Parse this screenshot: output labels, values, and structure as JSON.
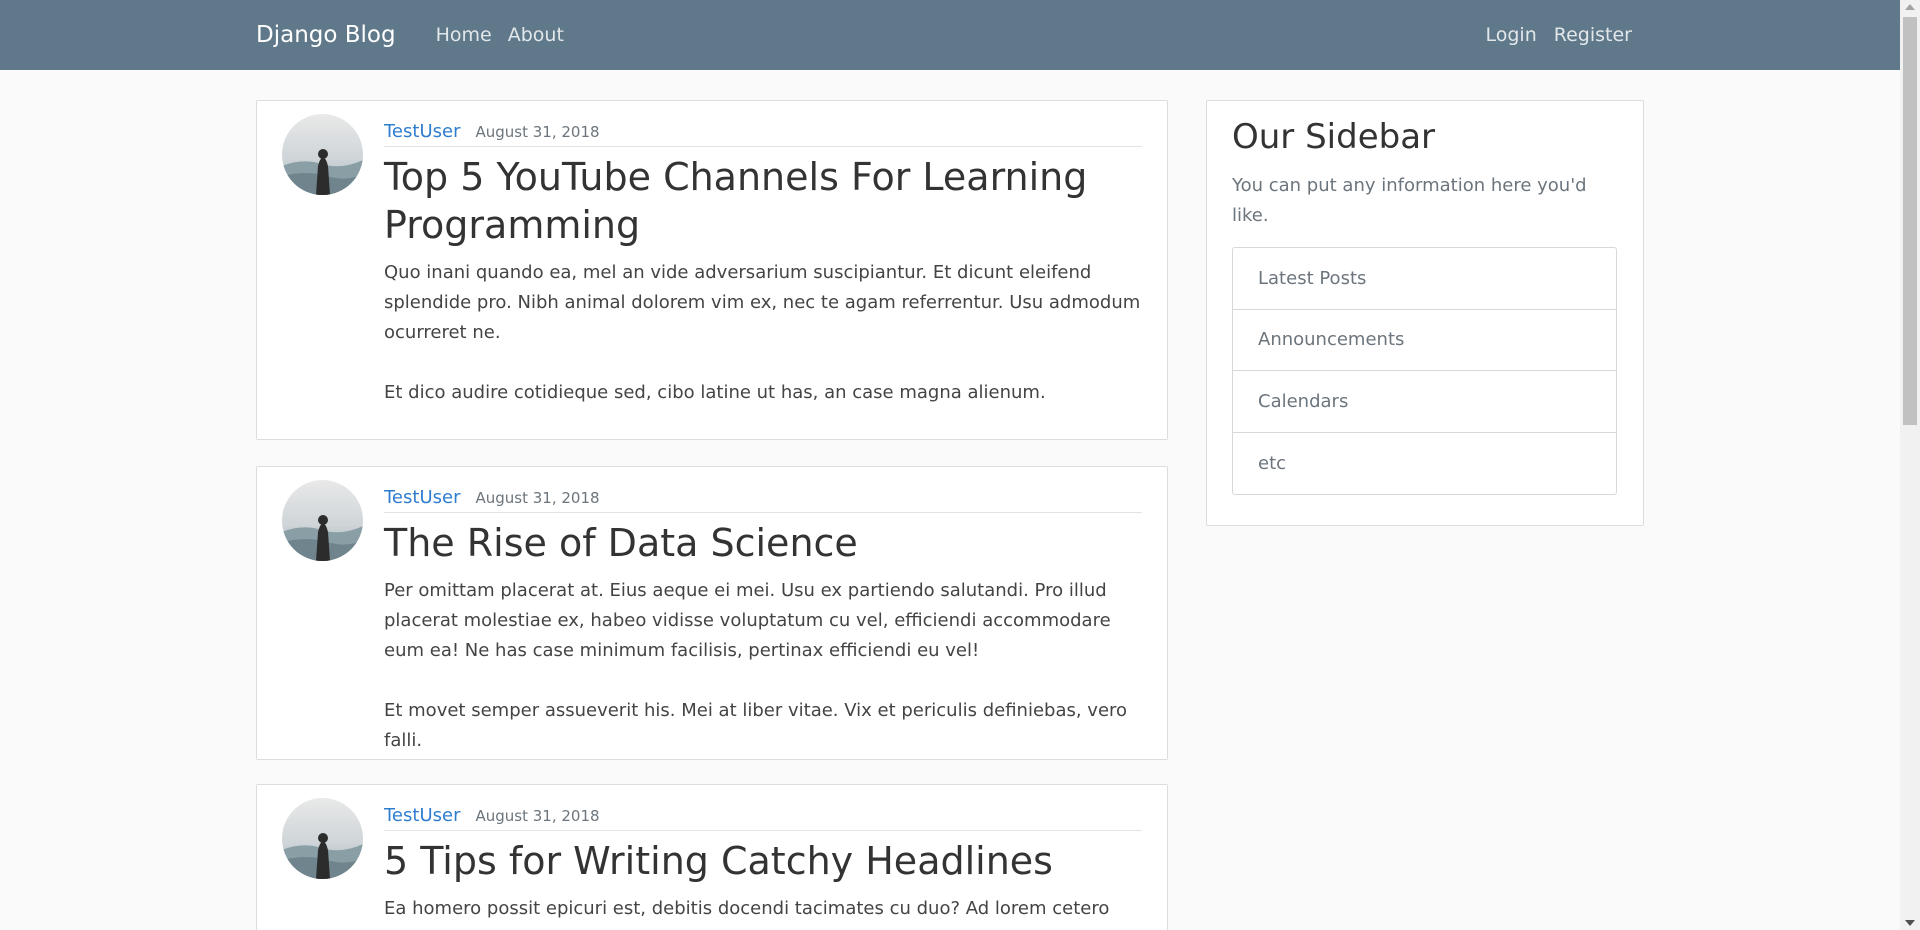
{
  "navbar": {
    "brand": "Django Blog",
    "links": [
      "Home",
      "About"
    ],
    "right_links": [
      "Login",
      "Register"
    ],
    "background": "#5f788a"
  },
  "posts": [
    {
      "author": "TestUser",
      "date": "August 31, 2018",
      "title": "Top 5 YouTube Channels For Learning Programming",
      "paragraphs": [
        "Quo inani quando ea, mel an vide adversarium suscipiantur. Et dicunt eleifend splendide pro. Nibh animal dolorem vim ex, nec te agam referrentur. Usu admodum ocurreret ne.",
        "Et dico audire cotidieque sed, cibo latine ut has, an case magna alienum."
      ]
    },
    {
      "author": "TestUser",
      "date": "August 31, 2018",
      "title": "The Rise of Data Science",
      "paragraphs": [
        "Per omittam placerat at. Eius aeque ei mei. Usu ex partiendo salutandi. Pro illud placerat molestiae ex, habeo vidisse voluptatum cu vel, efficiendi accommodare eum ea! Ne has case minimum facilisis, pertinax efficiendi eu vel!",
        "Et movet semper assueverit his. Mei at liber vitae. Vix et periculis definiebas, vero falli."
      ]
    },
    {
      "author": "TestUser",
      "date": "August 31, 2018",
      "title": "5 Tips for Writing Catchy Headlines",
      "paragraphs": [
        "Ea homero possit epicuri est, debitis docendi tacimates cu duo? Ad lorem cetero"
      ]
    }
  ],
  "sidebar": {
    "title": "Our Sidebar",
    "description": "You can put any information here you'd like.",
    "items": [
      "Latest Posts",
      "Announcements",
      "Calendars",
      "etc"
    ]
  },
  "colors": {
    "link": "#2f7dcf",
    "muted": "#6c757d",
    "page_background": "#fafafa"
  }
}
